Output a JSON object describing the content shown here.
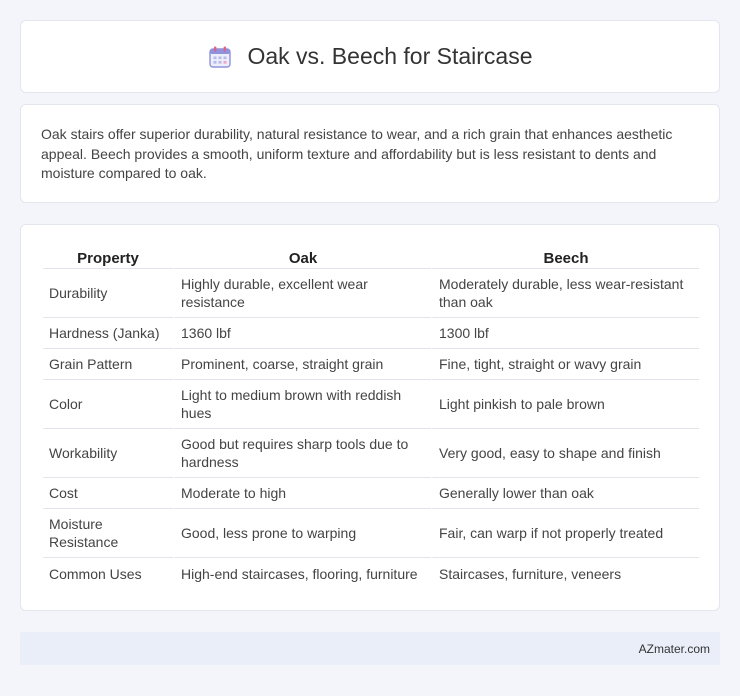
{
  "header": {
    "title": "Oak vs. Beech for Staircase",
    "icon": "calendar-icon"
  },
  "summary": {
    "text": "Oak stairs offer superior durability, natural resistance to wear, and a rich grain that enhances aesthetic appeal. Beech provides a smooth, uniform texture and affordability but is less resistant to dents and moisture compared to oak."
  },
  "table": {
    "headers": [
      "Property",
      "Oak",
      "Beech"
    ],
    "rows": [
      [
        "Durability",
        "Highly durable, excellent wear resistance",
        "Moderately durable, less wear-resistant than oak"
      ],
      [
        "Hardness (Janka)",
        "1360 lbf",
        "1300 lbf"
      ],
      [
        "Grain Pattern",
        "Prominent, coarse, straight grain",
        "Fine, tight, straight or wavy grain"
      ],
      [
        "Color",
        "Light to medium brown with reddish hues",
        "Light pinkish to pale brown"
      ],
      [
        "Workability",
        "Good but requires sharp tools due to hardness",
        "Very good, easy to shape and finish"
      ],
      [
        "Cost",
        "Moderate to high",
        "Generally lower than oak"
      ],
      [
        "Moisture Resistance",
        "Good, less prone to warping",
        "Fair, can warp if not properly treated"
      ],
      [
        "Common Uses",
        "High-end staircases, flooring, furniture",
        "Staircases, furniture, veneers"
      ]
    ]
  },
  "footer": {
    "brand": "AZmater.com"
  },
  "colors": {
    "background": "#f3f5fa",
    "card": "#ffffff",
    "footer": "#e9eef8",
    "icon_accent": "#7b7fd6"
  }
}
